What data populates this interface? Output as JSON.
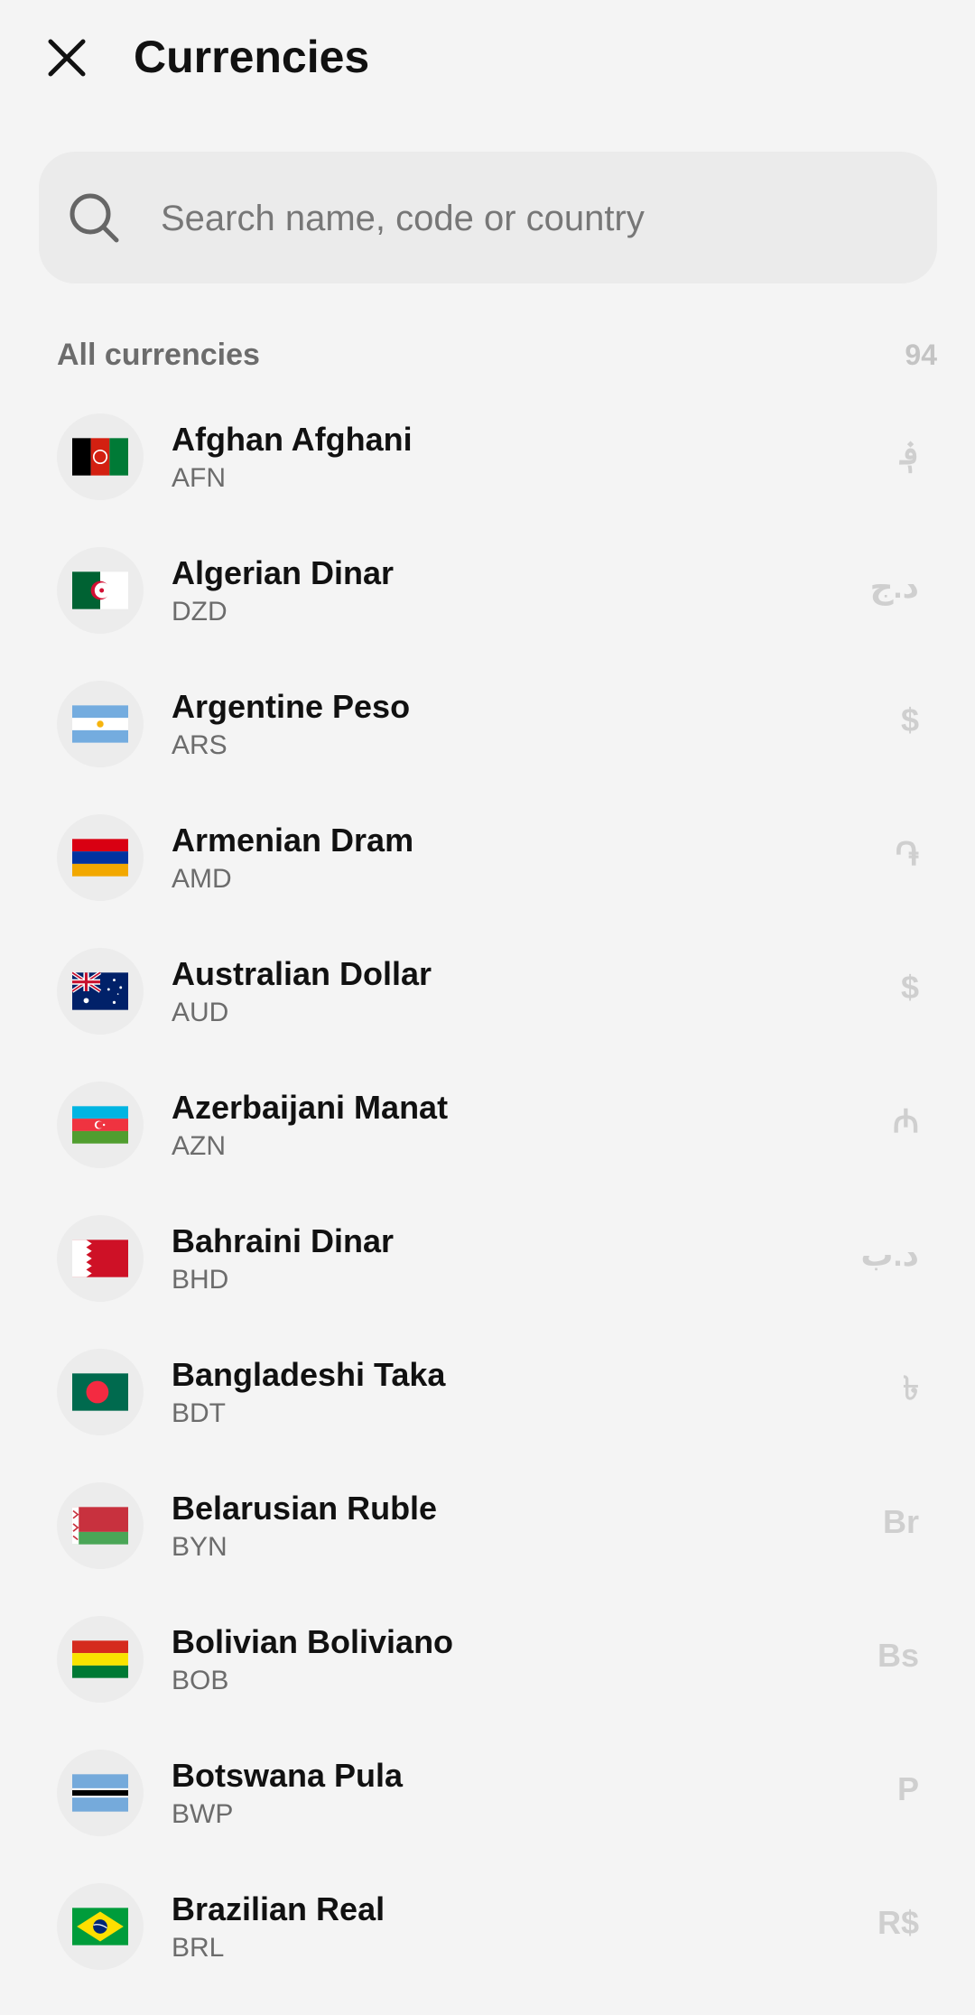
{
  "header": {
    "title": "Currencies",
    "close_icon": "close-icon"
  },
  "search": {
    "placeholder": "Search name, code or country",
    "value": "",
    "icon": "search-icon"
  },
  "section": {
    "title": "All currencies",
    "count": "94"
  },
  "currencies": [
    {
      "name": "Afghan Afghani",
      "code": "AFN",
      "symbol": "؋",
      "flag_icon": "afghanistan-flag-icon"
    },
    {
      "name": "Algerian Dinar",
      "code": "DZD",
      "symbol": "د.ج",
      "flag_icon": "algeria-flag-icon"
    },
    {
      "name": "Argentine Peso",
      "code": "ARS",
      "symbol": "$",
      "flag_icon": "argentina-flag-icon"
    },
    {
      "name": "Armenian Dram",
      "code": "AMD",
      "symbol": "֏",
      "flag_icon": "armenia-flag-icon"
    },
    {
      "name": "Australian Dollar",
      "code": "AUD",
      "symbol": "$",
      "flag_icon": "australia-flag-icon"
    },
    {
      "name": "Azerbaijani Manat",
      "code": "AZN",
      "symbol": "₼",
      "flag_icon": "azerbaijan-flag-icon"
    },
    {
      "name": "Bahraini Dinar",
      "code": "BHD",
      "symbol": "د.ب",
      "flag_icon": "bahrain-flag-icon"
    },
    {
      "name": "Bangladeshi Taka",
      "code": "BDT",
      "symbol": "৳",
      "flag_icon": "bangladesh-flag-icon"
    },
    {
      "name": "Belarusian Ruble",
      "code": "BYN",
      "symbol": "Br",
      "flag_icon": "belarus-flag-icon"
    },
    {
      "name": "Bolivian Boliviano",
      "code": "BOB",
      "symbol": "Bs",
      "flag_icon": "bolivia-flag-icon"
    },
    {
      "name": "Botswana Pula",
      "code": "BWP",
      "symbol": "P",
      "flag_icon": "botswana-flag-icon"
    },
    {
      "name": "Brazilian Real",
      "code": "BRL",
      "symbol": "R$",
      "flag_icon": "brazil-flag-icon"
    }
  ],
  "colors": {
    "background": "#f4f4f4",
    "search_bg": "#ebebeb",
    "primary_text": "#111111",
    "secondary_text": "#6c6c6c",
    "symbol_text": "#cfcfcf"
  }
}
